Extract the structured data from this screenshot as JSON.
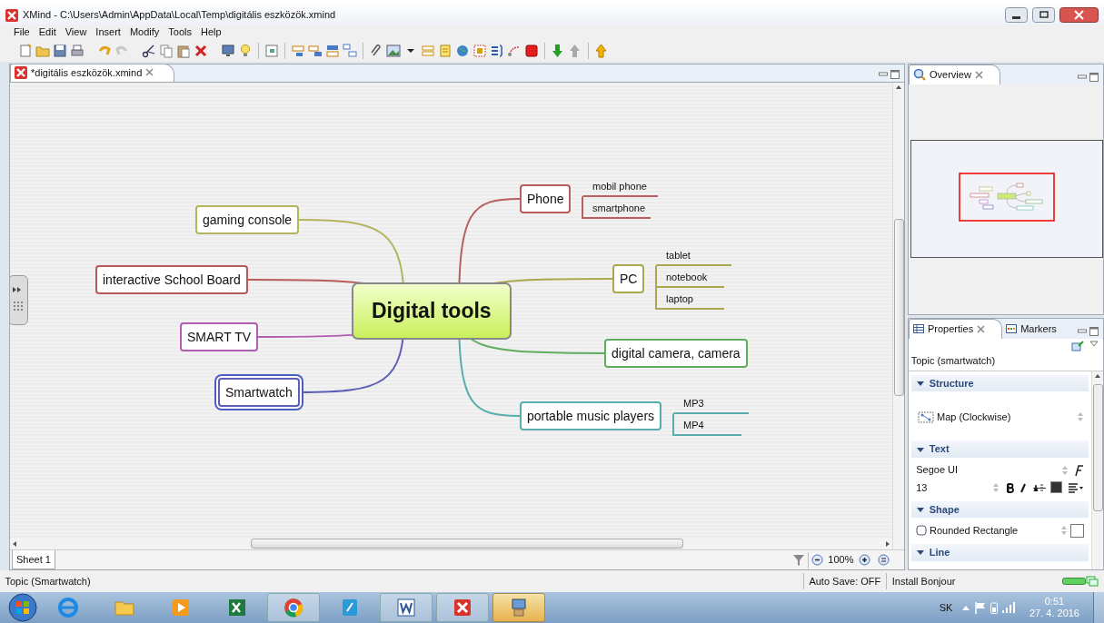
{
  "window": {
    "title": "XMind - C:\\Users\\Admin\\AppData\\Local\\Temp\\digitális eszközök.xmind"
  },
  "menu": [
    "File",
    "Edit",
    "View",
    "Insert",
    "Modify",
    "Tools",
    "Help"
  ],
  "editor_tab": {
    "label": "*digitális eszközök.xmind"
  },
  "map": {
    "central": "Digital tools",
    "topics": [
      {
        "label": "Phone",
        "color": "#b85f5f",
        "selected": false,
        "children": [
          {
            "label": "mobil phone"
          },
          {
            "label": "smartphone"
          }
        ]
      },
      {
        "label": "PC",
        "color": "#a9a850",
        "selected": false,
        "children": [
          {
            "label": "tablet"
          },
          {
            "label": "notebook"
          },
          {
            "label": "laptop"
          }
        ]
      },
      {
        "label": "digital camera, camera",
        "color": "#5fae5f",
        "selected": false
      },
      {
        "label": "portable music players",
        "color": "#5aadad",
        "selected": false,
        "children": [
          {
            "label": "MP3"
          },
          {
            "label": "MP4"
          }
        ]
      },
      {
        "label": "gaming console",
        "color": "#b4b45e",
        "selected": false
      },
      {
        "label": "interactive School Board",
        "color": "#b45c5c",
        "selected": false
      },
      {
        "label": "SMART TV",
        "color": "#b35db3",
        "selected": false
      },
      {
        "label": "Smartwatch",
        "color": "#5e5eb6",
        "selected": true
      }
    ]
  },
  "sheet_tab": "Sheet 1",
  "zoom": "100%",
  "overview": {
    "tab": "Overview"
  },
  "properties": {
    "tabs": [
      {
        "label": "Properties",
        "selected": true
      },
      {
        "label": "Markers",
        "selected": false
      }
    ],
    "heading": "Topic (smartwatch)",
    "sections": [
      {
        "kind": "structure",
        "title": "Structure",
        "expanded": true,
        "value": "Map (Clockwise)"
      },
      {
        "kind": "text",
        "title": "Text",
        "expanded": true,
        "font": "Segoe UI",
        "size": "13"
      },
      {
        "kind": "shape",
        "title": "Shape",
        "expanded": true,
        "value": "Rounded Rectangle"
      },
      {
        "kind": "header",
        "title": "Line",
        "expanded": true
      }
    ]
  },
  "status_bar": {
    "selection": "Topic (Smartwatch)",
    "auto_save": "Auto Save: OFF",
    "message": "Install Bonjour"
  },
  "taskbar": {
    "language": "SK",
    "time": "0:51",
    "date": "27. 4. 2016"
  }
}
